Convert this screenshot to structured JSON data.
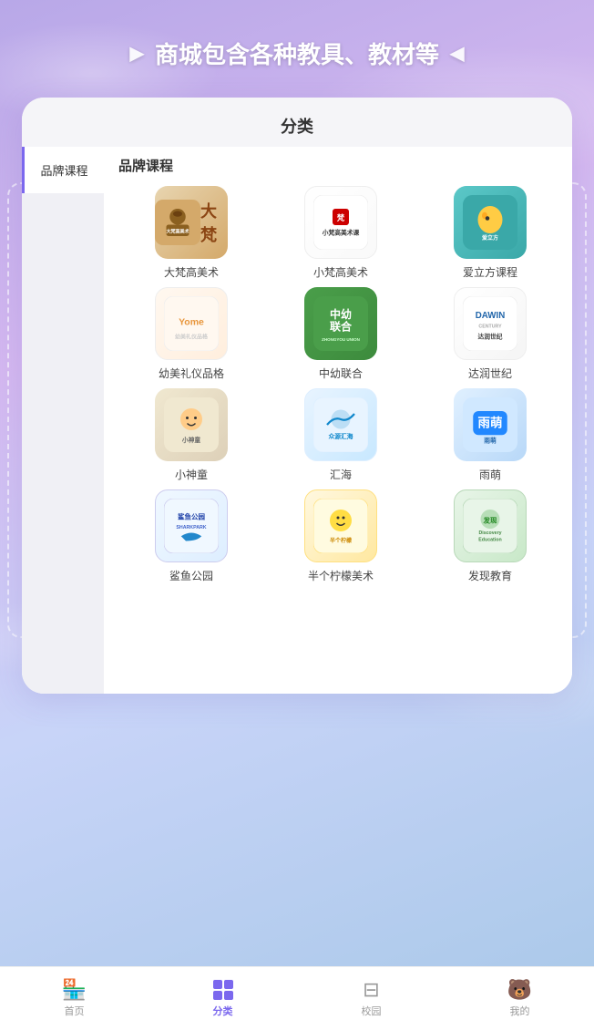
{
  "banner": {
    "text": "商城包含各种教具、教材等",
    "arrow_left": "▶",
    "arrow_right": "◀"
  },
  "card": {
    "title": "分类",
    "sidebar": {
      "items": [
        {
          "id": "brand",
          "label": "品牌课程",
          "active": true
        }
      ]
    },
    "content": {
      "section_title": "品牌课程",
      "brands": [
        {
          "id": "dafan",
          "name": "大梵高美术",
          "logo_class": "logo-dafan",
          "text": "大梵高美术"
        },
        {
          "id": "xiaofan",
          "name": "小梵高美术",
          "logo_class": "logo-xiaofan",
          "text": "小梵高美术课"
        },
        {
          "id": "alifang",
          "name": "爱立方课程",
          "logo_class": "logo-alifang",
          "text": "🦆"
        },
        {
          "id": "youmei",
          "name": "幼美礼仪品格",
          "logo_class": "logo-youmei",
          "text": "Yome"
        },
        {
          "id": "zhongyou",
          "name": "中幼联合",
          "logo_class": "logo-zhongyou",
          "text": "中幼联合"
        },
        {
          "id": "darun",
          "name": "达润世纪",
          "logo_class": "logo-darun",
          "text": "DAWIN"
        },
        {
          "id": "xiaoshentong",
          "name": "小神童",
          "logo_class": "logo-xiaoshentong",
          "text": "🧒"
        },
        {
          "id": "huihai",
          "name": "汇海",
          "logo_class": "logo-huihai",
          "text": "众源汇海"
        },
        {
          "id": "yumeng",
          "name": "雨萌",
          "logo_class": "logo-yumeng",
          "text": "雨萌"
        },
        {
          "id": "shayugongyuan",
          "name": "鲨鱼公园",
          "logo_class": "logo-shayugongyuan",
          "text": "鲨鱼公园"
        },
        {
          "id": "bangelemon",
          "name": "半个柠檬美术",
          "logo_class": "logo-bangelemon",
          "text": "半个柠檬"
        },
        {
          "id": "faxianjy",
          "name": "发现教育",
          "logo_class": "logo-faxianjy",
          "text": "发现教育"
        }
      ]
    }
  },
  "bottom_nav": {
    "items": [
      {
        "id": "home",
        "icon": "🏪",
        "label": "首页",
        "active": false
      },
      {
        "id": "category",
        "icon": "⊞",
        "label": "分类",
        "active": true
      },
      {
        "id": "campus",
        "icon": "⊟",
        "label": "校园",
        "active": false
      },
      {
        "id": "mine",
        "icon": "🐻",
        "label": "我的",
        "active": false
      }
    ]
  }
}
